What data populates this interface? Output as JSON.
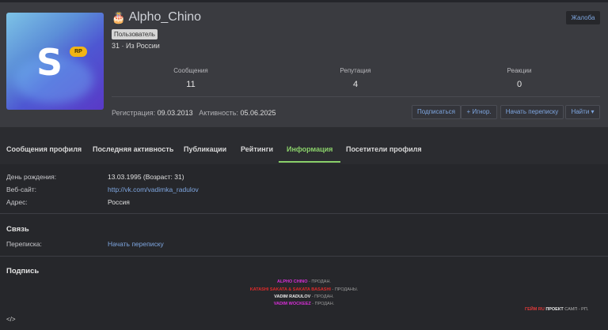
{
  "profile": {
    "username": "Alpho_Chino",
    "role": "Пользователь",
    "subline": "31 · Из России",
    "avatar_letter": "S",
    "avatar_badge": "RP",
    "report_label": "Жалоба"
  },
  "stats": [
    {
      "label": "Сообщения",
      "value": "11"
    },
    {
      "label": "Репутация",
      "value": "4"
    },
    {
      "label": "Реакции",
      "value": "0"
    }
  ],
  "dates": {
    "reg_label": "Регистрация:",
    "reg_value": "09.03.2013",
    "act_label": "Активность:",
    "act_value": "05.06.2025"
  },
  "actions": {
    "subscribe": "Подписаться",
    "ignore": "+ Игнор.",
    "message": "Начать переписку",
    "find": "Найти ▾"
  },
  "tabs": [
    "Сообщения профиля",
    "Последняя активность",
    "Публикации",
    "Рейтинги",
    "Информация",
    "Посетители профиля"
  ],
  "info": {
    "birthday_label": "День рождения:",
    "birthday_value": "13.03.1995 (Возраст: 31)",
    "website_label": "Веб-сайт:",
    "website_value": "http://vk.com/vadimka_radulov",
    "address_label": "Адрес:",
    "address_value": "Россия"
  },
  "contact": {
    "title": "Связь",
    "chat_label": "Переписка:",
    "chat_value": "Начать переписку"
  },
  "signature": {
    "title": "Подпись",
    "lines": [
      {
        "name": "ALPHO CHINO",
        "status": " - ПРОДАН.",
        "color": "#d92fd9"
      },
      {
        "name": "KATASHI SAKATA & SAKATA BASASHI",
        "status": " - ПРОДАНЫ.",
        "color": "#e02b2b"
      },
      {
        "name": "VADIM RADULOV",
        "status": " - ПРОДАН.",
        "color": "#e8e8e8"
      },
      {
        "name": "VADIM WOCKEEZ",
        "status": " - ПРОДАН.",
        "color": "#d92fd9"
      }
    ],
    "footer_red": "ГЕЙМ RU",
    "footer_white": " ПРОЕКТ",
    "footer_grey": " САМП - РП.",
    "code": "</>"
  },
  "colors": {
    "accent_tab": "#8ad06a",
    "link": "#7ea6e0",
    "page_bg": "#2b2c30",
    "header_bg": "#3a3b40"
  }
}
